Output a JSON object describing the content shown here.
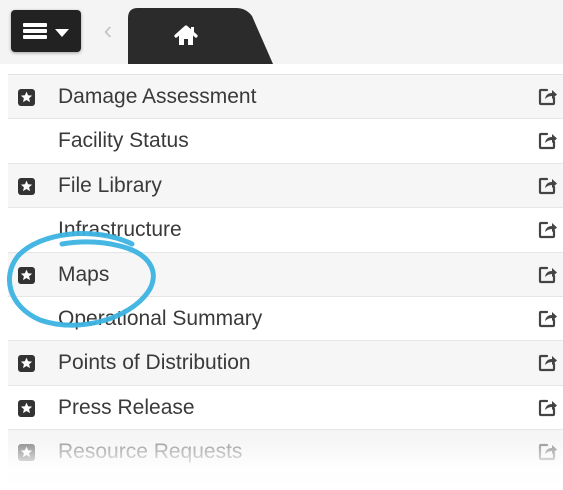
{
  "toolbar": {
    "menu_icon": "hamburger-menu-icon",
    "back_icon": "chevron-left-icon",
    "home_icon": "home-icon"
  },
  "list": {
    "items": [
      {
        "label": "Damage Assessment",
        "starred": true
      },
      {
        "label": "Facility Status",
        "starred": false
      },
      {
        "label": "File Library",
        "starred": true
      },
      {
        "label": "Infrastructure",
        "starred": false
      },
      {
        "label": "Maps",
        "starred": true
      },
      {
        "label": "Operational Summary",
        "starred": false
      },
      {
        "label": "Points of Distribution",
        "starred": true
      },
      {
        "label": "Press Release",
        "starred": true
      },
      {
        "label": "Resource Requests",
        "starred": true
      }
    ],
    "share_icon": "share-icon",
    "star_icon": "star-badge-icon"
  },
  "annotation": {
    "type": "circle-highlight",
    "target": "Maps",
    "color": "#3bb3e0"
  },
  "colors": {
    "toolbar_button": "#222222",
    "text": "#3a3a3a",
    "row_stripe": "#f6f6f6"
  }
}
